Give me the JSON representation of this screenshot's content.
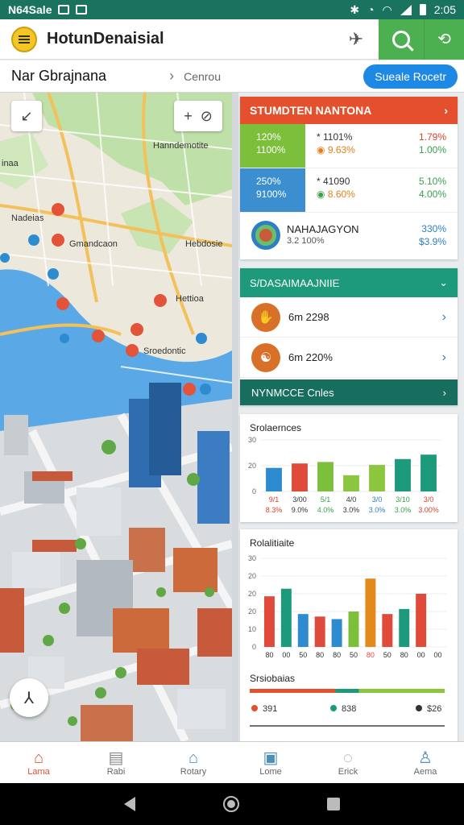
{
  "status_bar": {
    "time_left": "N64Sale",
    "time_right": "2:05"
  },
  "app": {
    "title": "HotunDenaisial"
  },
  "location": {
    "name": "Nar Gbrajnana",
    "sub": "Cenrou",
    "button": "Sueale Rocetr"
  },
  "map": {
    "labels": [
      "Hanndemotite",
      "inaa",
      "Nadeias",
      "Gmandcaon",
      "Hebdosie",
      "Hettioa",
      "Sroedontic"
    ],
    "zoom_in": "+",
    "icons": {
      "compass": "compass-icon",
      "locate": "locate-icon",
      "fab": "route-icon"
    }
  },
  "panel_stats": {
    "header": "STUMDTEN NANTONA",
    "rows": [
      {
        "tile_a": "120%",
        "tile_b": "1100%",
        "mid_a": "* 1101%",
        "mid_b": "9.63%",
        "right_a": "1.79%",
        "right_b": "1.00%"
      },
      {
        "tile_a": "250%",
        "tile_b": "9100%",
        "mid_a": "* 41090",
        "mid_b": "8.60%",
        "right_a": "5.10%",
        "right_b": "4.00%"
      }
    ],
    "footer": {
      "title": "NAHAJAGYON",
      "sub": "3.2 100%",
      "right_a": "330%",
      "right_b": "$3.9%"
    }
  },
  "panel_list": {
    "header": "S/DASAIMAAJNIIE",
    "items": [
      {
        "label": "6m 2298"
      },
      {
        "label": "6m 220%"
      }
    ],
    "footer": "NYNMCCE Cnles"
  },
  "chart_one": {
    "chart_data": {
      "type": "bar",
      "title": "Srolaernces",
      "y_ticks": [
        "30",
        "20",
        "0"
      ],
      "ylim": [
        0,
        35
      ],
      "categories": [
        "9/1",
        "3/00",
        "5/1",
        "4/0",
        "3/0",
        "3/10",
        "3/0"
      ],
      "values": [
        16,
        19,
        20,
        11,
        18,
        22,
        25
      ],
      "colors": [
        "#2d8ccf",
        "#e04a3a",
        "#7bbf3a",
        "#8cc63f",
        "#8cc63f",
        "#1d9a7b",
        "#1d9a7b"
      ],
      "value_labels": [
        "8.3%",
        "9.0%",
        "4.0%",
        "3.0%",
        "3.0%",
        "3.0%",
        "3.00%"
      ],
      "label_colors": [
        "#d84325",
        "#333",
        "#3aa04a",
        "#333",
        "#2d7fc1",
        "#3aa04a",
        "#d84325"
      ]
    }
  },
  "chart_two": {
    "chart_data": {
      "type": "bar",
      "title": "Rolalitiaite",
      "y_ticks": [
        "30",
        "20",
        "20",
        "20",
        "10",
        "0"
      ],
      "ylim": [
        0,
        35
      ],
      "categories": [
        "80",
        "00",
        "50",
        "80",
        "80",
        "50",
        "80",
        "50",
        "80",
        "00",
        "00"
      ],
      "values": [
        20,
        23,
        13,
        12,
        11,
        14,
        27,
        13,
        15,
        21,
        0
      ],
      "colors": [
        "#e04a3a",
        "#1d9a7b",
        "#2d8ccf",
        "#e04a3a",
        "#2d8ccf",
        "#7bbf3a",
        "#e38a1d",
        "#e04a3a",
        "#1d9a7b",
        "#e04a3a",
        "#7bbf3a"
      ],
      "label_colors": [
        "#333",
        "#333",
        "#333",
        "#333",
        "#333",
        "#333",
        "#e04a3a",
        "#333",
        "#333",
        "#333",
        "#333"
      ]
    },
    "sub_title": "Srsiobaias",
    "segments": [
      {
        "color": "#e4502d",
        "frac": 0.44
      },
      {
        "color": "#1d9a7b",
        "frac": 0.12
      },
      {
        "color": "#8cc63f",
        "frac": 0.44
      }
    ],
    "legend": [
      {
        "icon": "pin-icon",
        "label": "391",
        "color": "#e4502d"
      },
      {
        "icon": "pin-icon",
        "label": "838",
        "color": "#1d9a7b"
      },
      {
        "icon": "checkbox-icon",
        "label": "$26",
        "color": "#333"
      }
    ]
  },
  "bottom_nav": [
    {
      "label": "Lama",
      "icon": "home-icon",
      "active": true
    },
    {
      "label": "Rabi",
      "icon": "package-icon"
    },
    {
      "label": "Rotary",
      "icon": "building-icon"
    },
    {
      "label": "Lome",
      "icon": "box-icon"
    },
    {
      "label": "Erick",
      "icon": "chat-icon"
    },
    {
      "label": "Aema",
      "icon": "person-icon"
    }
  ]
}
